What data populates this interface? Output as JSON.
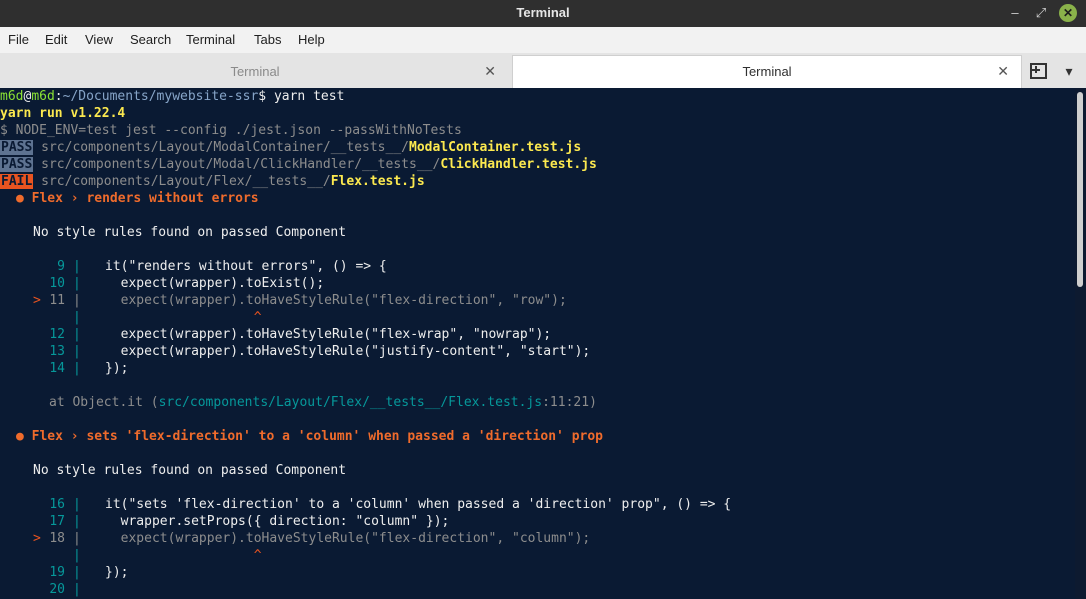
{
  "window": {
    "title": "Terminal"
  },
  "menu": [
    "File",
    "Edit",
    "View",
    "Search",
    "Terminal",
    "Tabs",
    "Help"
  ],
  "tabs": [
    {
      "label": "Terminal",
      "active": false
    },
    {
      "label": "Terminal",
      "active": true
    }
  ],
  "icons": {
    "minimize": "minimize-icon",
    "maximize": "maximize-icon",
    "close": "close-icon",
    "new_tab": "new-tab-icon",
    "tab_menu": "chevron-down-icon"
  },
  "terminal": {
    "prompt": {
      "user": "m6d",
      "at": "@",
      "host": "m6d",
      "sep": ":",
      "path": "~/Documents/mywebsite-ssr",
      "dollar": "$ ",
      "command": "yarn test"
    },
    "yarn_version": "yarn run v1.22.4",
    "jest_cmd": "$ NODE_ENV=test jest --config ./jest.json --passWithNoTests",
    "results": [
      {
        "status": "PASS",
        "dir": "src/components/Layout/ModalContainer/__tests__/",
        "file": "ModalContainer.test.js"
      },
      {
        "status": "PASS",
        "dir": "src/components/Layout/Modal/ClickHandler/__tests__/",
        "file": "ClickHandler.test.js"
      },
      {
        "status": "FAIL",
        "dir": "src/components/Layout/Flex/__tests__/",
        "file": "Flex.test.js"
      }
    ],
    "failures": [
      {
        "title": "● Flex › renders without errors",
        "message": "No style rules found on passed Component",
        "code": [
          {
            "marker": "",
            "num": "9",
            "code": "it(\"renders without errors\", () => {"
          },
          {
            "marker": "",
            "num": "10",
            "code": "  expect(wrapper).toExist();"
          },
          {
            "marker": ">",
            "num": "11",
            "code": "  expect(wrapper).toHaveStyleRule(\"flex-direction\", \"row\");"
          },
          {
            "marker": "",
            "num": "",
            "code": "                   ^"
          },
          {
            "marker": "",
            "num": "12",
            "code": "  expect(wrapper).toHaveStyleRule(\"flex-wrap\", \"nowrap\");"
          },
          {
            "marker": "",
            "num": "13",
            "code": "  expect(wrapper).toHaveStyleRule(\"justify-content\", \"start\");"
          },
          {
            "marker": "",
            "num": "14",
            "code": "});"
          }
        ],
        "stack": {
          "prefix": "at Object.it (",
          "path": "src/components/Layout/Flex/__tests__/Flex.test.js",
          "loc": ":11:21",
          "suffix": ")"
        }
      },
      {
        "title": "● Flex › sets 'flex-direction' to a 'column' when passed a 'direction' prop",
        "message": "No style rules found on passed Component",
        "code": [
          {
            "marker": "",
            "num": "16",
            "code": "it(\"sets 'flex-direction' to a 'column' when passed a 'direction' prop\", () => {"
          },
          {
            "marker": "",
            "num": "17",
            "code": "  wrapper.setProps({ direction: \"column\" });"
          },
          {
            "marker": ">",
            "num": "18",
            "code": "  expect(wrapper).toHaveStyleRule(\"flex-direction\", \"column\");"
          },
          {
            "marker": "",
            "num": "",
            "code": "                   ^"
          },
          {
            "marker": "",
            "num": "19",
            "code": "});"
          },
          {
            "marker": "",
            "num": "20",
            "code": ""
          }
        ]
      }
    ]
  },
  "colors": {
    "background": "#0a1a33",
    "pass_badge": "#5e7391",
    "fail_badge": "#e95420",
    "prompt_green": "#8ae234",
    "highlight_yellow": "#fce94f"
  }
}
